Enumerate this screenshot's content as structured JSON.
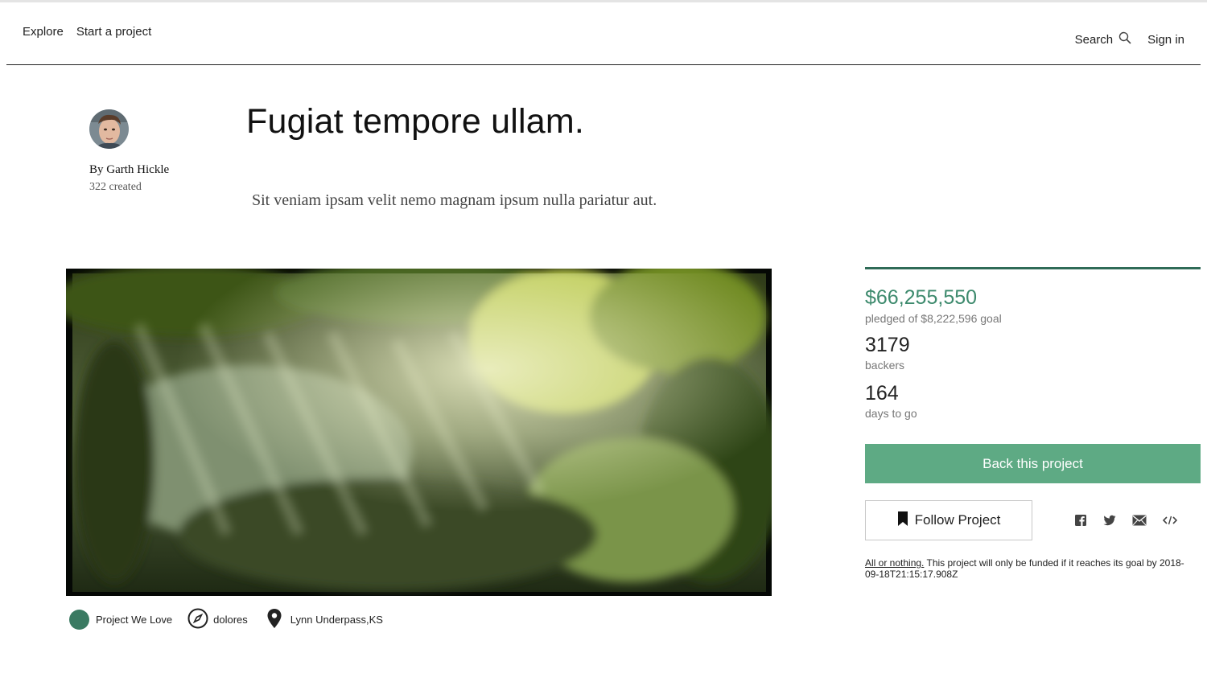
{
  "header": {
    "nav_explore": "Explore",
    "nav_start": "Start a project",
    "search_label": "Search",
    "sign_in": "Sign in"
  },
  "creator": {
    "by_line": "By Garth Hickle",
    "created_count": "322 created"
  },
  "project": {
    "title": "Fugiat tempore ullam.",
    "blurb": "Sit veniam ipsam velit nemo magnam ipsum nulla pariatur aut.",
    "tags": {
      "badge": "Project We Love",
      "category": "dolores",
      "location": "Lynn Underpass,KS"
    }
  },
  "stats": {
    "pledged": "$66,255,550",
    "pledged_label": "pledged of $8,222,596 goal",
    "backers": "3179",
    "backers_label": "backers",
    "days": "164",
    "days_label": "days to go"
  },
  "actions": {
    "back_project": "Back this project",
    "follow_project": "Follow Project"
  },
  "funding_note": {
    "link": "All or nothing.",
    "text": " This project will only be funded if it reaches its goal by 2018-09-18T21:15:17.908Z"
  },
  "icons": {
    "search": "search-icon",
    "bookmark": "bookmark-icon",
    "facebook": "facebook-icon",
    "twitter": "twitter-icon",
    "email": "email-icon",
    "embed": "embed-icon",
    "compass": "compass-icon",
    "pin": "map-pin-icon"
  },
  "colors": {
    "accent": "#5eaa84",
    "pledged_text": "#3d8a6d",
    "progress": "#2f6b57",
    "badge_dot": "#3a7a62"
  }
}
